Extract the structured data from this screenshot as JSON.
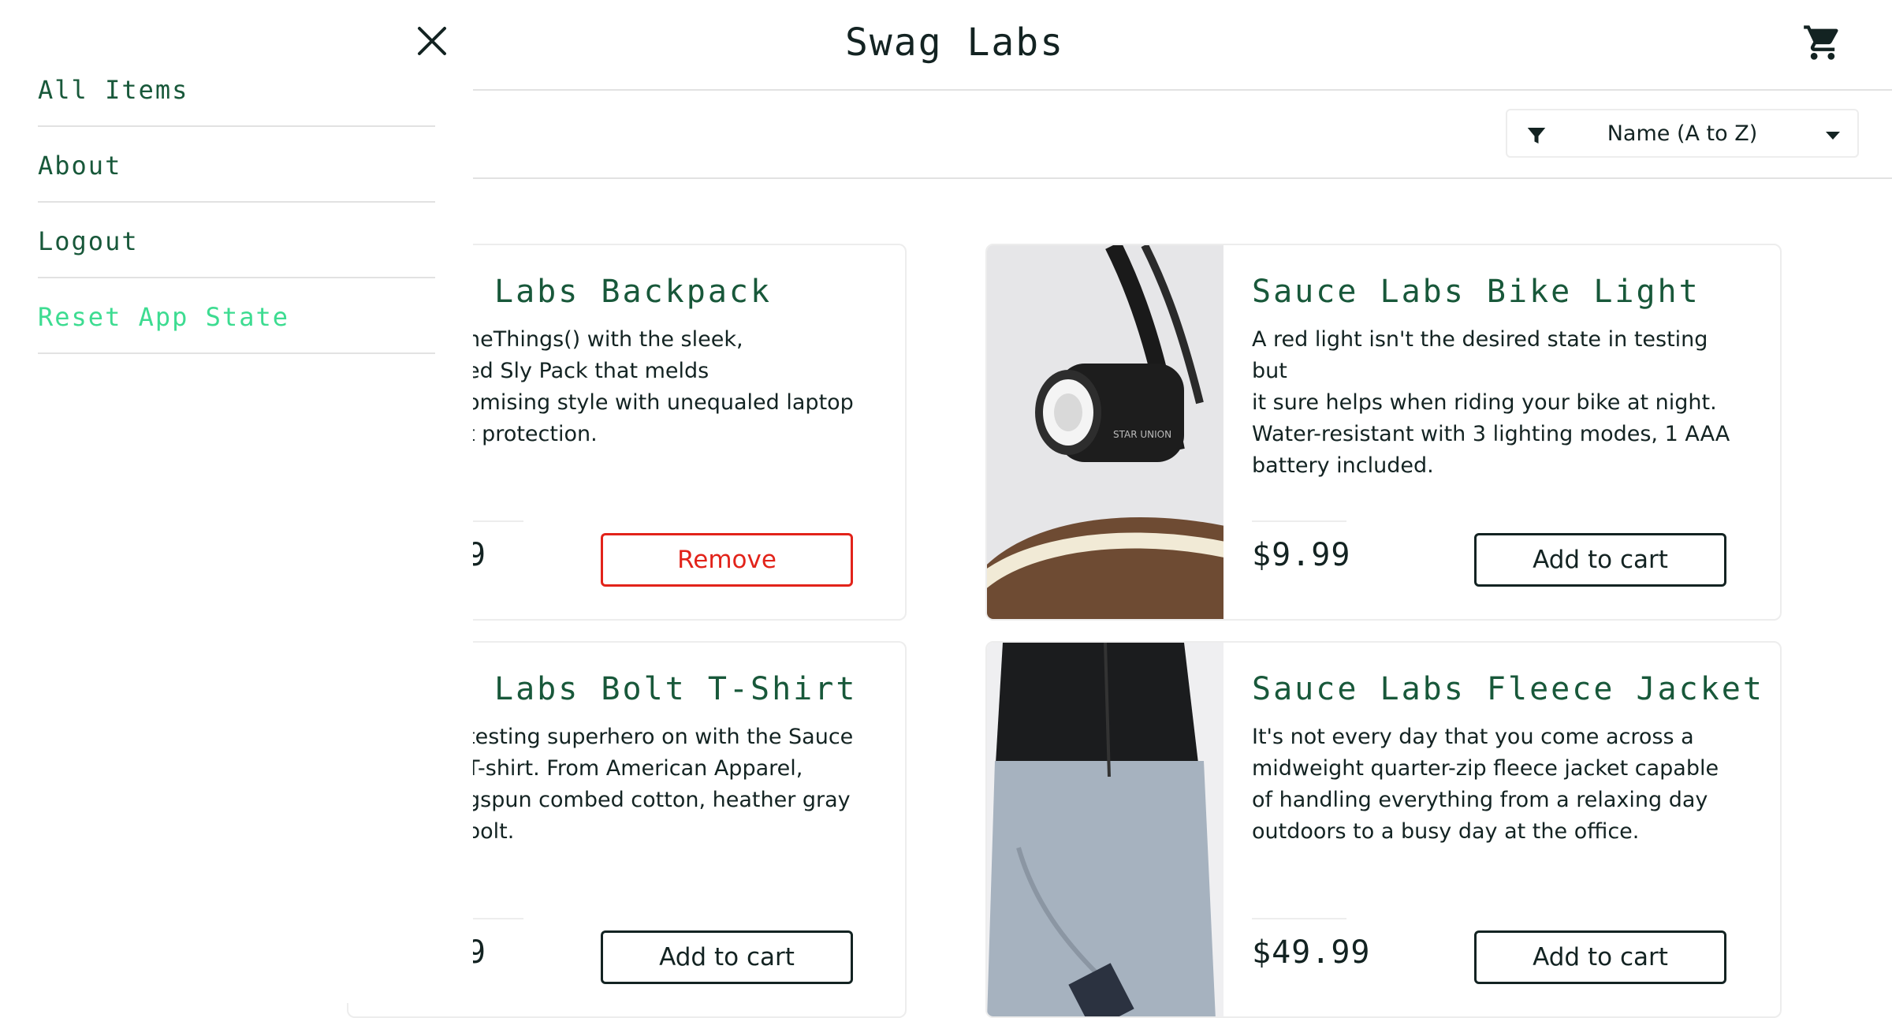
{
  "header": {
    "title": "Swag Labs",
    "cart_icon": "shopping-cart-icon"
  },
  "sort": {
    "selected": "Name (A to Z)",
    "filter_icon": "filter-icon",
    "caret_icon": "caret-down-icon"
  },
  "menu": {
    "close_icon": "close-icon",
    "items": [
      {
        "label": "All Items"
      },
      {
        "label": "About"
      },
      {
        "label": "Logout"
      },
      {
        "label": "Reset App State"
      }
    ]
  },
  "products": [
    {
      "name": "Labs Backpack",
      "desc": [
        "neThings() with the sleek,",
        "ed Sly Pack that melds",
        "omising style with unequaled laptop",
        "t protection."
      ],
      "price": "9",
      "button": "Remove"
    },
    {
      "name": "Sauce Labs Bike Light",
      "desc": [
        "A red light isn't the desired state in testing but",
        "it sure helps when riding your bike at night.",
        "Water-resistant with 3 lighting modes, 1 AAA",
        "battery included."
      ],
      "price": "$9.99",
      "button": "Add to cart"
    },
    {
      "name": "Labs Bolt T-Shirt",
      "desc": [
        "testing superhero on with the Sauce",
        "T-shirt. From American Apparel,",
        "gspun combed cotton, heather gray",
        "bolt."
      ],
      "price": "9",
      "button": "Add to cart"
    },
    {
      "name": "Sauce Labs Fleece Jacket",
      "desc": [
        "It's not every day that you come across a",
        "midweight quarter-zip fleece jacket capable",
        "of handling everything from a relaxing day",
        "outdoors to a busy day at the office."
      ],
      "price": "$49.99",
      "button": "Add to cart"
    }
  ],
  "colors": {
    "accent": "#18583a",
    "remove": "#e2231a",
    "reset": "#3ddc91"
  }
}
